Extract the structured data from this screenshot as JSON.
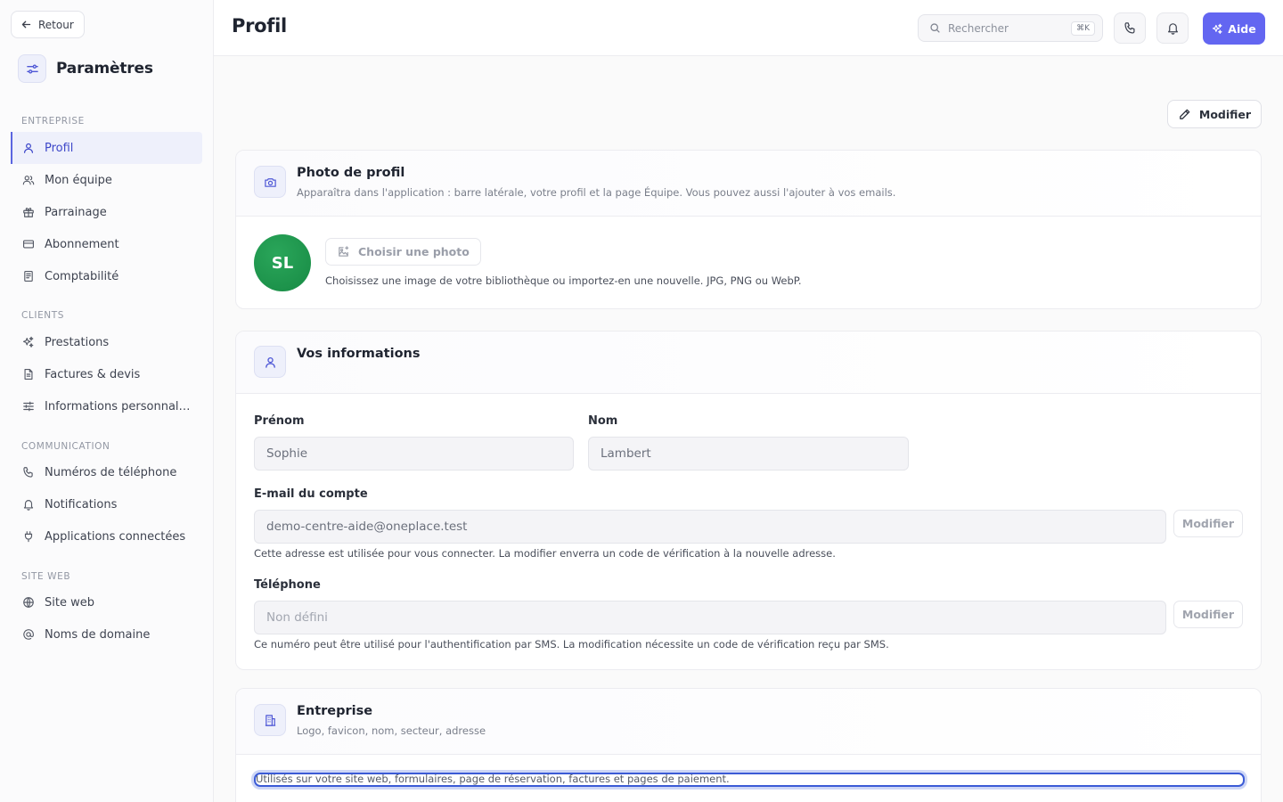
{
  "sidebar": {
    "back_label": "Retour",
    "title": "Paramètres",
    "sections": [
      {
        "label": "ENTREPRISE"
      },
      {
        "label": "CLIENTS"
      },
      {
        "label": "COMMUNICATION"
      },
      {
        "label": "SITE WEB"
      }
    ],
    "items": [
      {
        "label": "Profil",
        "icon": "user-icon",
        "active": true
      },
      {
        "label": "Mon équipe",
        "icon": "users-icon"
      },
      {
        "label": "Parrainage",
        "icon": "gift-icon"
      },
      {
        "label": "Abonnement",
        "icon": "credit-card-icon"
      },
      {
        "label": "Comptabilité",
        "icon": "receipt-icon"
      },
      {
        "label": "Prestations",
        "icon": "sparkles-icon"
      },
      {
        "label": "Factures & devis",
        "icon": "document-icon"
      },
      {
        "label": "Informations personnalis...",
        "icon": "sliders-icon"
      },
      {
        "label": "Numéros de téléphone",
        "icon": "phone-icon"
      },
      {
        "label": "Notifications",
        "icon": "bell-icon"
      },
      {
        "label": "Applications connectées",
        "icon": "plug-icon"
      },
      {
        "label": "Site web",
        "icon": "globe-icon"
      },
      {
        "label": "Noms de domaine",
        "icon": "at-icon"
      }
    ]
  },
  "header": {
    "title": "Profil",
    "search_placeholder": "Rechercher",
    "search_shortcut": "⌘K",
    "help_label": "Aide"
  },
  "main": {
    "edit_label": "Modifier",
    "photo_card": {
      "title": "Photo de profil",
      "subtitle": "Apparaîtra dans l'application : barre latérale, votre profil et la page Équipe. Vous pouvez aussi l'ajouter à vos emails.",
      "avatar_initials": "SL",
      "choose_label": "Choisir une photo",
      "hint": "Choisissez une image de votre bibliothèque ou importez-en une nouvelle. JPG, PNG ou WebP."
    },
    "info_card": {
      "title": "Vos informations",
      "first_name_label": "Prénom",
      "first_name_value": "Sophie",
      "last_name_label": "Nom",
      "last_name_value": "Lambert",
      "email_label": "E-mail du compte",
      "email_value": "demo-centre-aide@oneplace.test",
      "email_edit_label": "Modifier",
      "email_hint": "Cette adresse est utilisée pour vous connecter. La modifier enverra un code de vérification à la nouvelle adresse.",
      "phone_label": "Téléphone",
      "phone_value": "Non défini",
      "phone_edit_label": "Modifier",
      "phone_hint": "Ce numéro peut être utilisé pour l'authentification par SMS. La modification nécessite un code de vérification reçu par SMS."
    },
    "company_card": {
      "title": "Entreprise",
      "subtitle": "Logo, favicon, nom, secteur, adresse",
      "hint": "Utilisés sur votre site web, formulaires, page de réservation, factures et pages de paiement."
    }
  },
  "colors": {
    "accent": "#6366f1",
    "active_nav_text": "#3d47c9",
    "avatar_bg": "#1f9a4f"
  }
}
